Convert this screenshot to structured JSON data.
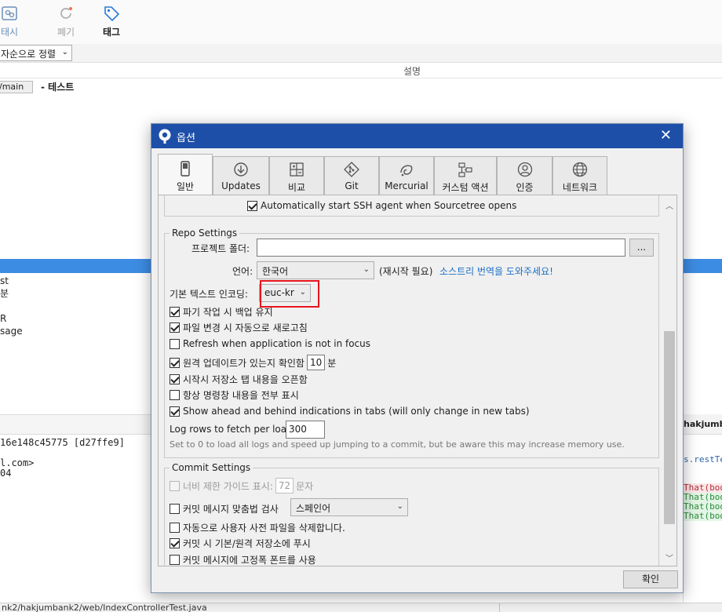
{
  "toolbar": {
    "stash_label": "태시",
    "discard_label": "폐기",
    "tag_label": "태그"
  },
  "sort": {
    "selected": "자순으로 정렬"
  },
  "history": {
    "description_header": "설명",
    "branch_chip": "/main",
    "commit_message": "- 테스트"
  },
  "left_list": [
    "st",
    "분",
    "",
    "R",
    "sage"
  ],
  "commit_info": [
    "16e148c45775 [d27ffe9]",
    "",
    "l.com>",
    "04"
  ],
  "right_pane": {
    "header": "hakjumbank",
    "code_lines": [
      {
        "text": "s.restTem",
        "kind": "blue"
      },
      {
        "text": "",
        "kind": "plain"
      },
      {
        "text": "",
        "kind": "plain"
      },
      {
        "text": "That(body",
        "kind": "red"
      },
      {
        "text": "That(body",
        "kind": "green"
      },
      {
        "text": "That(body",
        "kind": "green"
      },
      {
        "text": "That(body",
        "kind": "green"
      }
    ]
  },
  "status_bar": {
    "path": "nk2/hakjumbank2/web/IndexControllerTest.java"
  },
  "dialog": {
    "title": "옵션",
    "tabs": [
      {
        "label": "일반",
        "icon": "general-icon",
        "active": true
      },
      {
        "label": "Updates",
        "icon": "updates-icon",
        "active": false
      },
      {
        "label": "비교",
        "icon": "diff-icon",
        "active": false
      },
      {
        "label": "Git",
        "icon": "git-icon",
        "active": false
      },
      {
        "label": "Mercurial",
        "icon": "mercurial-icon",
        "active": false
      },
      {
        "label": "커스텀 액션",
        "icon": "custom-actions-icon",
        "active": false
      },
      {
        "label": "인증",
        "icon": "auth-icon",
        "active": false
      },
      {
        "label": "네트워크",
        "icon": "network-icon",
        "active": false
      }
    ],
    "ssh_agent": {
      "label": "Automatically start SSH agent when Sourcetree opens",
      "checked": true
    },
    "repo_settings": {
      "title": "Repo Settings",
      "project_folder_label": "프로젝트 폴더:",
      "project_folder_value": "",
      "browse_label": "...",
      "language_label": "언어:",
      "language_value": "한국어",
      "restart_note": "(재시작 필요)",
      "translate_link": "소스트리 번역을 도와주세요!",
      "encoding_label": "기본 텍스트 인코딩:",
      "encoding_value": "euc-kr",
      "options": [
        {
          "label": "파기 작업 시 백업 유지",
          "checked": true
        },
        {
          "label": "파일 변경 시 자동으로 새로고침",
          "checked": true
        },
        {
          "label": "Refresh when application is not in focus",
          "checked": false
        }
      ],
      "remote_check": {
        "prefix": "원격 업데이트가 있는지 확인함",
        "value": "10",
        "suffix": "분",
        "checked": true
      },
      "options2": [
        {
          "label": "시작시 저장소 탭 내용을 오픈함",
          "checked": true
        },
        {
          "label": "항상 명령창 내용을 전부 표시",
          "checked": false
        },
        {
          "label": "Show ahead and behind indications in tabs (will only change in new tabs)",
          "checked": true
        }
      ],
      "log_rows_label": "Log rows to fetch per load:",
      "log_rows_value": "300",
      "log_rows_hint": "Set to 0 to load all logs and speed up jumping to a commit, but be aware this may increase memory use."
    },
    "commit_settings": {
      "title": "Commit Settings",
      "width_guide": {
        "prefix": "너비 제한 가이드 표시:",
        "value": "72",
        "suffix": "문자",
        "checked": false,
        "disabled": true
      },
      "spell_check": {
        "label": "커밋 메시지 맞춤법 검사",
        "language": "스페인어",
        "checked": false
      },
      "delete_dict": {
        "label": "자동으로 사용자 사전 파일을 삭제합니다.",
        "checked": false
      },
      "push_on_commit": {
        "label": "커밋 시 기본/원격 저장소에 푸시",
        "checked": true
      },
      "fixed_font": {
        "label": "커밋 메시지에 고정폭 폰트를 사용",
        "checked": false
      }
    },
    "ok_label": "확인"
  },
  "colors": {
    "titlebar": "#1e4fa8",
    "selection": "#3d8ce3",
    "highlight_box": "#e8141c",
    "link": "#1a6fc6"
  }
}
